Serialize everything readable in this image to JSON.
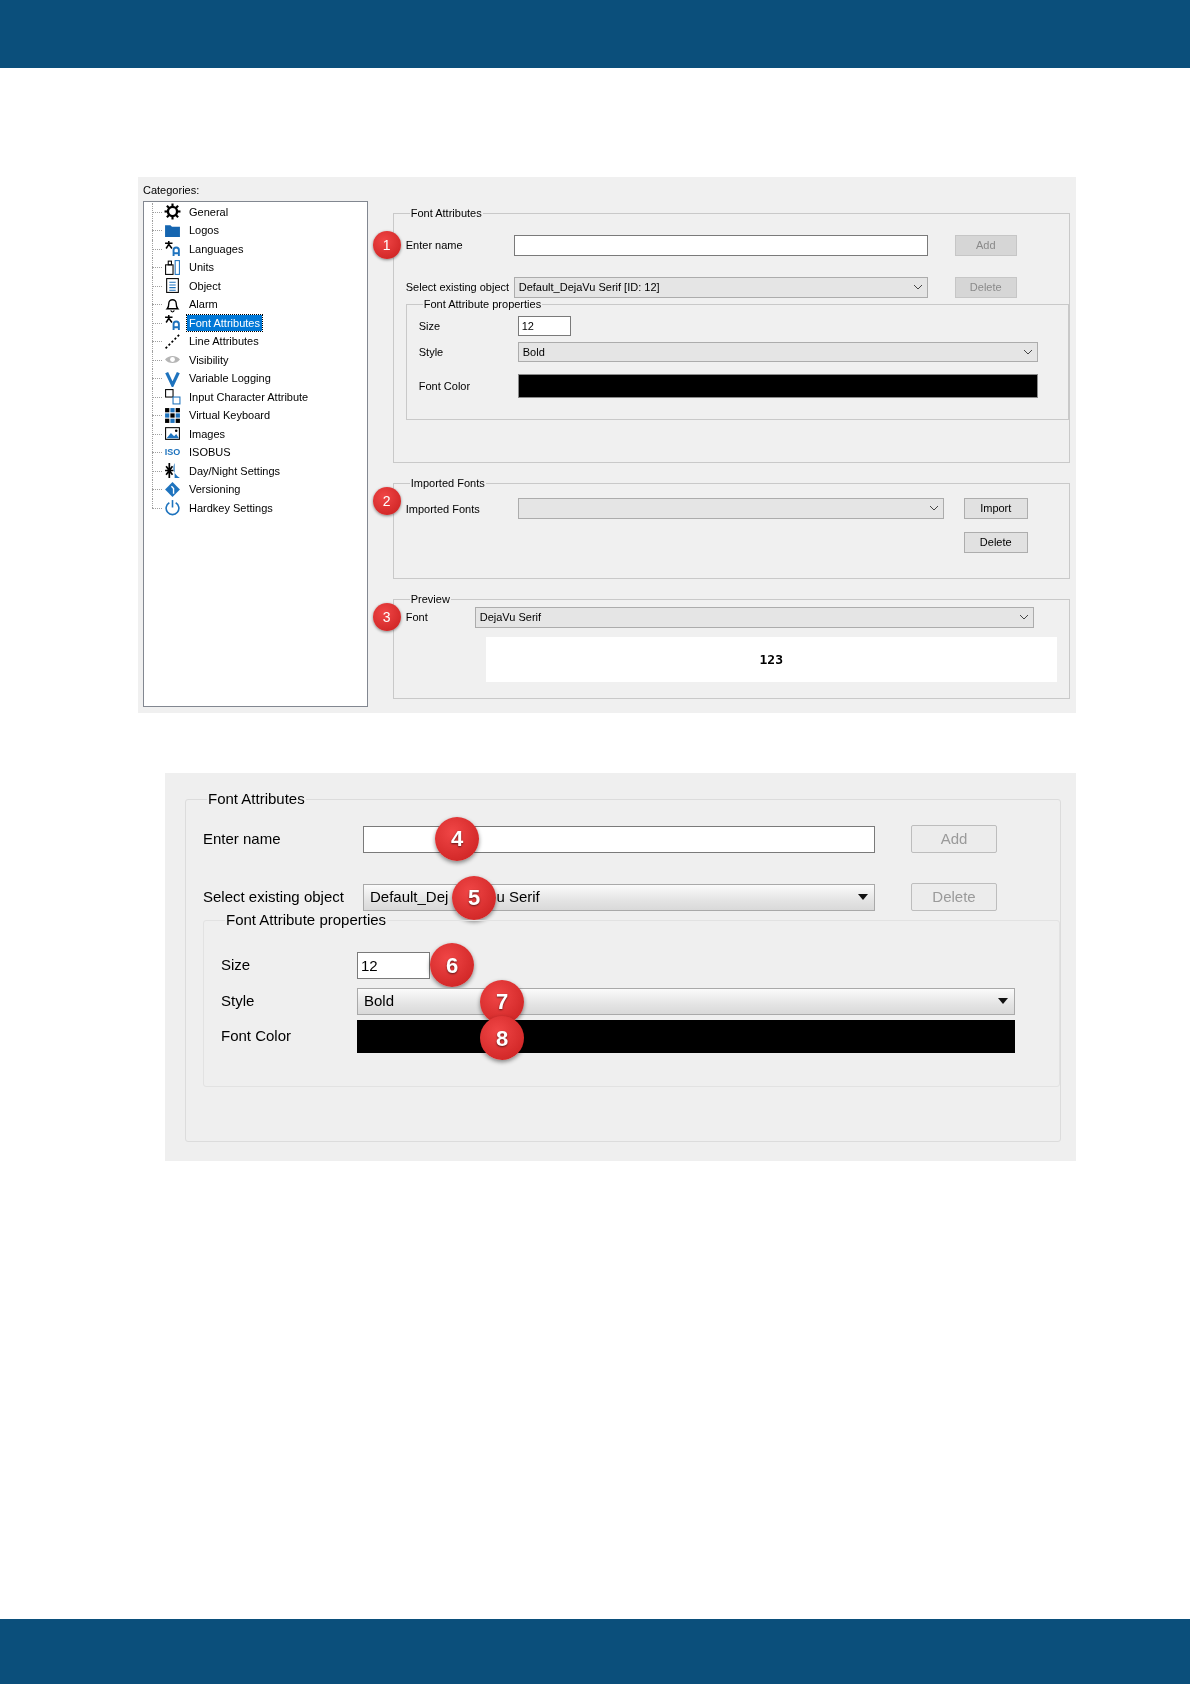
{
  "dialog": {
    "categories_label": "Categories:",
    "tree": [
      {
        "label": "General",
        "selected": false
      },
      {
        "label": "Logos",
        "selected": false
      },
      {
        "label": "Languages",
        "selected": false
      },
      {
        "label": "Units",
        "selected": false
      },
      {
        "label": "Object",
        "selected": false
      },
      {
        "label": "Alarm",
        "selected": false
      },
      {
        "label": "Font Attributes",
        "selected": true
      },
      {
        "label": "Line Attributes",
        "selected": false
      },
      {
        "label": "Visibility",
        "selected": false
      },
      {
        "label": "Variable Logging",
        "selected": false
      },
      {
        "label": "Input Character Attribute",
        "selected": false
      },
      {
        "label": "Virtual Keyboard",
        "selected": false
      },
      {
        "label": "Images",
        "selected": false
      },
      {
        "label": "ISOBUS",
        "selected": false,
        "icon_text": "ISO"
      },
      {
        "label": "Day/Night Settings",
        "selected": false
      },
      {
        "label": "Versioning",
        "selected": false
      },
      {
        "label": "Hardkey Settings",
        "selected": false
      }
    ],
    "font_attributes": {
      "title": "Font Attributes",
      "name_row": {
        "label": "Enter name",
        "callout": "1",
        "button": {
          "label": "Add",
          "disabled": true
        }
      },
      "select_row": {
        "label": "Select existing object",
        "value": "Default_DejaVu Serif [ID: 12]",
        "button": {
          "label": "Delete",
          "disabled": true
        }
      },
      "properties": {
        "title": "Font Attribute properties",
        "size": {
          "label": "Size",
          "value": "12"
        },
        "style": {
          "label": "Style",
          "value": "Bold"
        },
        "font_color": {
          "label": "Font Color",
          "color": "#000000"
        }
      }
    },
    "imported_fonts": {
      "title": "Imported Fonts",
      "label": "Imported Fonts",
      "callout": "2",
      "buttons": [
        {
          "label": "Import",
          "disabled": false
        },
        {
          "label": "Delete",
          "disabled": false
        }
      ]
    },
    "preview": {
      "title": "Preview",
      "font_label": "Font",
      "font_value": "DejaVu Serif",
      "callout": "3",
      "sample": "123"
    }
  },
  "detail": {
    "font_attributes": {
      "title": "Font Attributes",
      "name_row": {
        "label": "Enter name",
        "callout": "4",
        "button": {
          "label": "Add",
          "disabled": true
        }
      },
      "select_row": {
        "label": "Select existing object",
        "value_parts": [
          "Default_Dej",
          "u Serif"
        ],
        "callout": "5",
        "button": {
          "label": "Delete",
          "disabled": true
        }
      },
      "properties": {
        "title": "Font Attribute properties",
        "size": {
          "label": "Size",
          "value": "12",
          "callout": "6"
        },
        "style": {
          "label": "Style",
          "value": "Bold",
          "callout": "7"
        },
        "font_color": {
          "label": "Font Color",
          "color": "#000000",
          "callout": "8"
        }
      }
    }
  }
}
